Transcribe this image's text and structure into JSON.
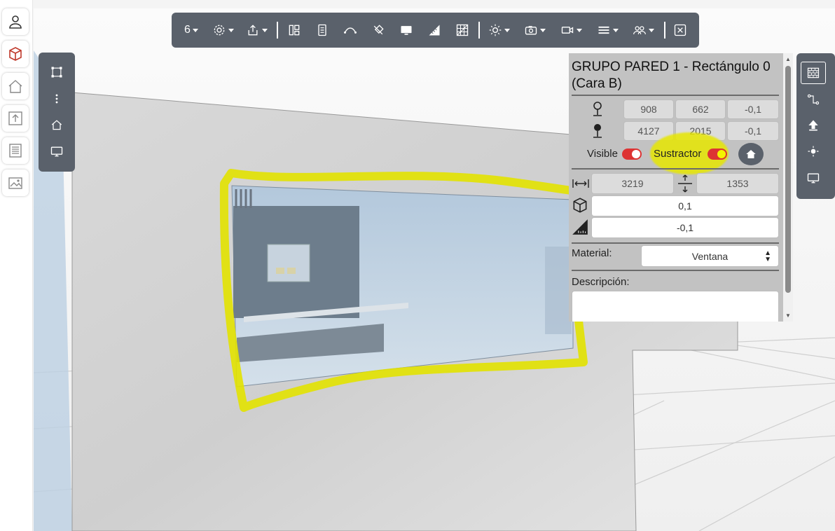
{
  "left_sidebar": {
    "items": [
      {
        "icon": "user-icon"
      },
      {
        "icon": "cube-icon"
      },
      {
        "icon": "house-icon"
      },
      {
        "icon": "upload-icon"
      },
      {
        "icon": "document-list-icon"
      },
      {
        "icon": "images-icon"
      }
    ]
  },
  "toolbar": {
    "level_label": "6",
    "items": [
      "settings-icon",
      "export-icon",
      "layout-icon",
      "document-icon",
      "curve-icon",
      "brush-icon",
      "monitor-icon",
      "ruler-icon",
      "grid-icon",
      "sun-icon",
      "camera-icon",
      "video-icon",
      "layers-icon",
      "users-icon",
      "close-icon"
    ]
  },
  "left_view_tools": [
    "select-box-icon",
    "more-icon",
    "home-icon",
    "monitor-icon"
  ],
  "right_view_tools": [
    "brick-wall-icon",
    "path-icon",
    "upload-arrow-icon",
    "sun-icon",
    "monitor-icon"
  ],
  "panel": {
    "title": "GRUPO PARED 1 - Rectángulo 0 (Cara B)",
    "start_point": {
      "x": "908",
      "y": "662",
      "z": "-0,1"
    },
    "end_point": {
      "x": "4127",
      "y": "2015",
      "z": "-0,1"
    },
    "visible_label": "Visible",
    "visible_on": true,
    "sustractor_label": "Sustractor",
    "sustractor_on": true,
    "width": "3219",
    "height": "1353",
    "depth": "0,1",
    "elevation": "-0,1",
    "material_label": "Material:",
    "material_value": "Ventana",
    "description_label": "Descripción:",
    "description_value": ""
  },
  "colors": {
    "toolbar_bg": "#5a616b",
    "panel_bg": "#c2c2c2",
    "toggle_on": "#d33333",
    "highlight": "#e6e600",
    "accent_cube": "#c0392b"
  }
}
